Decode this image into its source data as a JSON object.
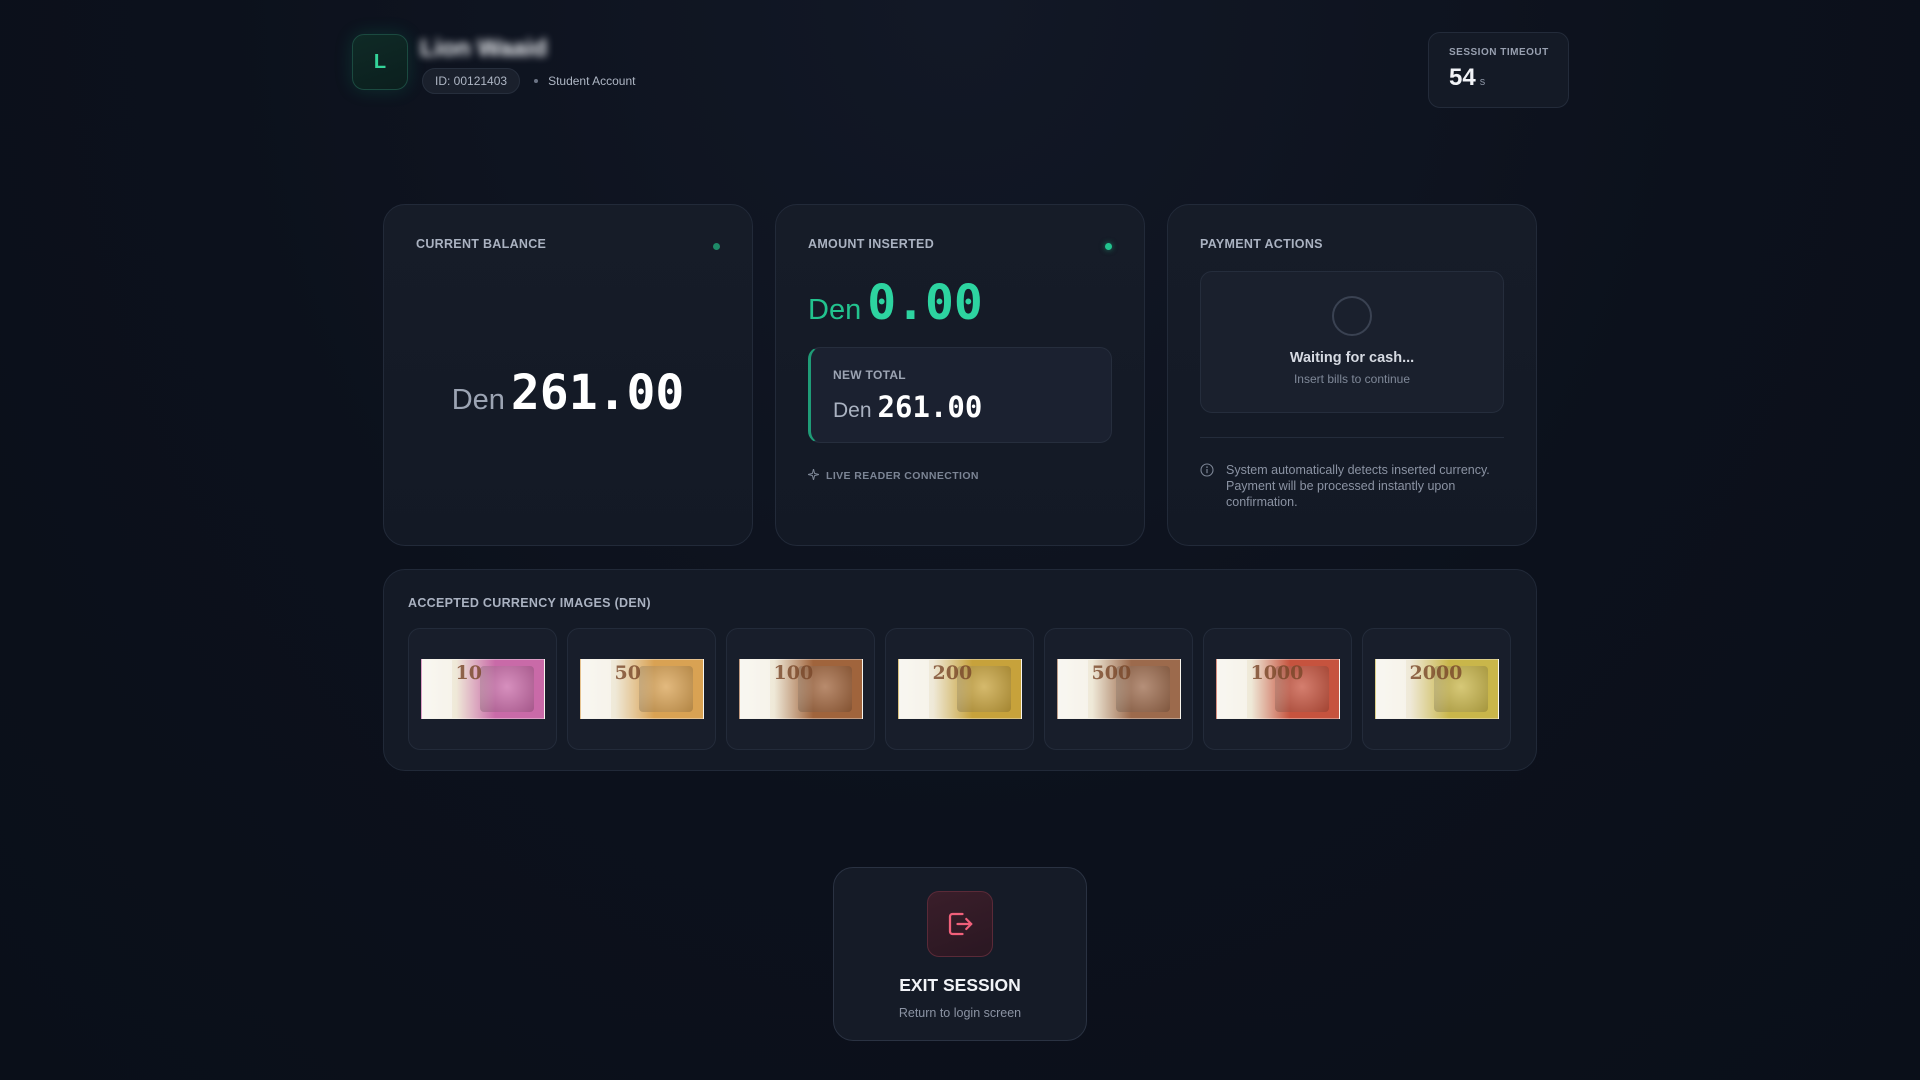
{
  "user": {
    "avatar_initial": "L",
    "name": "Lion Waaid",
    "id": "ID: 00121403",
    "account_type": "Student Account"
  },
  "session": {
    "timeout_label": "SESSION TIMEOUT",
    "timeout_value": "54",
    "timeout_unit": "s"
  },
  "balance": {
    "title": "CURRENT BALANCE",
    "currency": "Den",
    "amount": "261.00"
  },
  "inserted": {
    "title": "AMOUNT INSERTED",
    "currency": "Den",
    "amount": "0.00",
    "new_total_label": "NEW TOTAL",
    "new_total_currency": "Den",
    "new_total_amount": "261.00",
    "live_label": "LIVE READER CONNECTION"
  },
  "actions": {
    "title": "PAYMENT ACTIONS",
    "waiting_title": "Waiting for cash...",
    "waiting_sub": "Insert bills to continue",
    "info_text": "System automatically detects inserted currency. Payment will be processed instantly upon confirmation."
  },
  "currency": {
    "title": "ACCEPTED CURRENCY IMAGES (DEN)",
    "bills": [
      {
        "denomination": "10",
        "color": "#c96aa8"
      },
      {
        "denomination": "50",
        "color": "#d9a253"
      },
      {
        "denomination": "100",
        "color": "#a0643c"
      },
      {
        "denomination": "200",
        "color": "#c7a23b"
      },
      {
        "denomination": "500",
        "color": "#9c6a4c"
      },
      {
        "denomination": "1000",
        "color": "#c6533e"
      },
      {
        "denomination": "2000",
        "color": "#c9b64a"
      }
    ]
  },
  "exit": {
    "title": "EXIT SESSION",
    "subtitle": "Return to login screen"
  },
  "colors": {
    "accent_green": "#2dd4a0",
    "exit_red": "#f0607a"
  }
}
